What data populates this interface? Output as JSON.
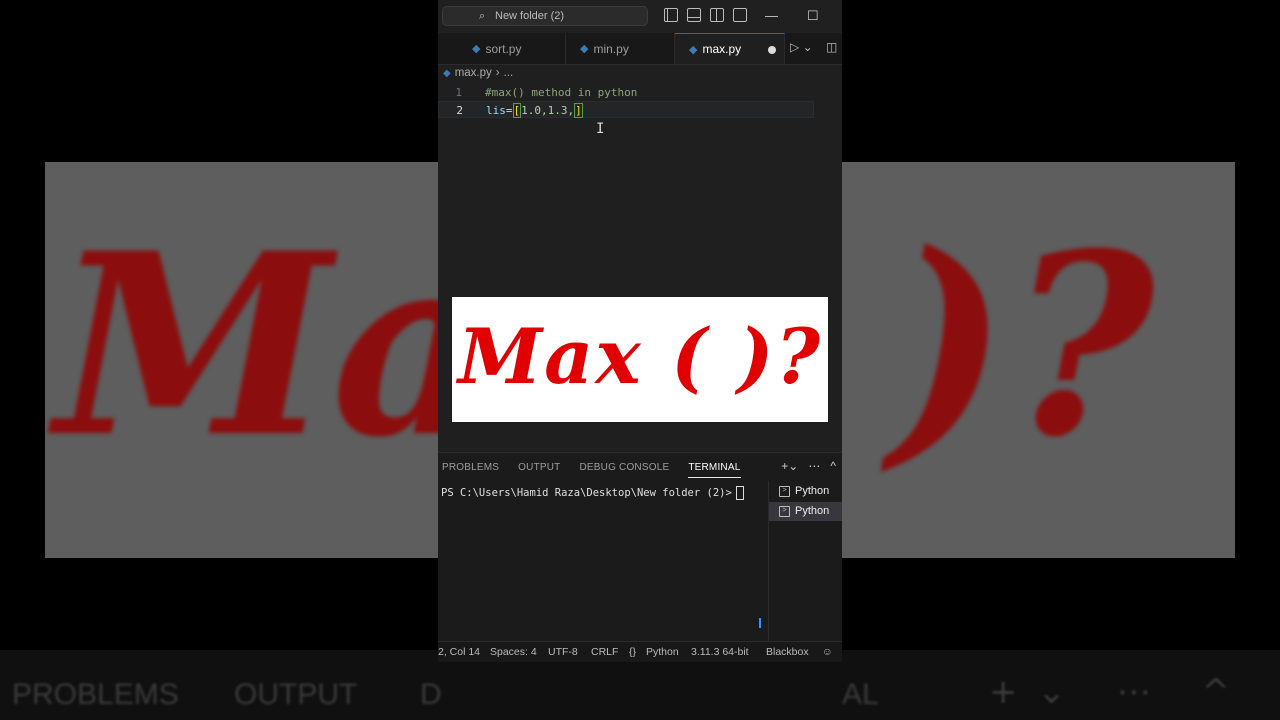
{
  "window": {
    "search_text": "New folder (2)",
    "minimize": "—",
    "maximize": "☐"
  },
  "tabs": [
    {
      "label": "sort.py"
    },
    {
      "label": "min.py"
    },
    {
      "label": "max.py",
      "active": true,
      "modified": true
    }
  ],
  "breadcrumb": {
    "file": "max.py",
    "more": "..."
  },
  "editor": {
    "lines": [
      {
        "num": "1",
        "comment": "#max() method in python"
      },
      {
        "num": "2",
        "var": "lis",
        "op": "=",
        "open": "[",
        "values": "1.0,1.3,",
        "close": "]"
      }
    ]
  },
  "overlay": {
    "title": "Max ( )?"
  },
  "background": {
    "left_text": "Ma",
    "right_text": ")?",
    "tabs": [
      "PROBLEMS",
      "OUTPUT",
      "D",
      "AL"
    ]
  },
  "panel": {
    "tabs": [
      "PROBLEMS",
      "OUTPUT",
      "DEBUG CONSOLE",
      "TERMINAL"
    ],
    "active_tab": "TERMINAL",
    "prompt": "PS C:\\Users\\Hamid Raza\\Desktop\\New folder (2)>",
    "terminals": [
      "Python",
      "Python"
    ]
  },
  "status": {
    "position": "2, Col 14",
    "spaces": "Spaces: 4",
    "encoding": "UTF-8",
    "eol": "CRLF",
    "language": "Python",
    "interpreter": "3.11.3 64-bit",
    "extension": "Blackbox"
  },
  "colors": {
    "accent": "#0078d4",
    "overlay_red": "#e00000",
    "python_blue": "#3d7bb8"
  }
}
